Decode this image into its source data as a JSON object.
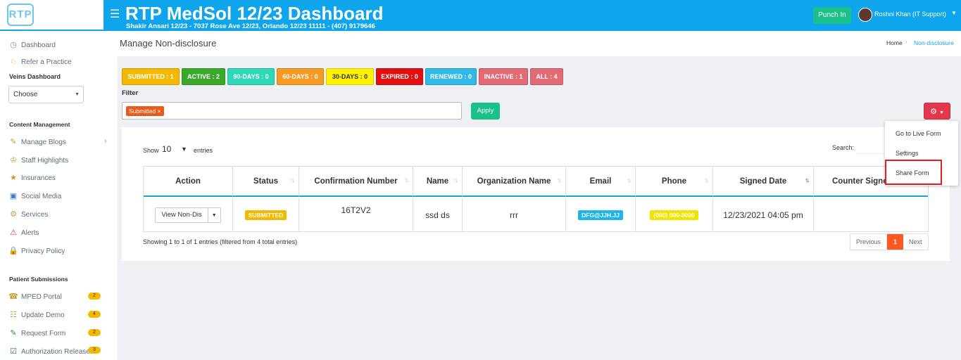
{
  "header": {
    "logo_text": "RTP",
    "title": "RTP MedSol 12/23 Dashboard",
    "subtitle": "Shakir Ansari 12/23 - 7037 Rose Ave 12/23, Orlando 12/23 11111 - (407) 9179646",
    "punch_label": "Punch In",
    "user_name": "Roshni Khan (IT Support)",
    "accent_color": "#0ea5ec"
  },
  "sidebar": {
    "items_top": [
      {
        "label": "Dashboard",
        "icon": "dashboard-icon"
      },
      {
        "label": "Refer a Practice",
        "icon": "refer-icon"
      }
    ],
    "veins_label": "Veins Dashboard",
    "choose_value": "Choose",
    "content_heading": "Content Management",
    "content_items": [
      {
        "label": "Manage Blogs",
        "icon": "blog-icon"
      },
      {
        "label": "Staff Highlights",
        "icon": "staff-icon"
      },
      {
        "label": "Insurances",
        "icon": "insurance-icon"
      },
      {
        "label": "Social Media",
        "icon": "social-icon"
      },
      {
        "label": "Services",
        "icon": "services-icon"
      },
      {
        "label": "Alerts",
        "icon": "alert-icon"
      },
      {
        "label": "Privacy Policy",
        "icon": "privacy-icon"
      }
    ],
    "patient_heading": "Patient Submissions",
    "patient_items": [
      {
        "label": "MPED Portal",
        "badge": "2"
      },
      {
        "label": "Update Demo",
        "badge": "4"
      },
      {
        "label": "Request Form",
        "badge": "2"
      },
      {
        "label": "Authorization Release",
        "badge": "3"
      }
    ]
  },
  "page": {
    "title": "Manage Non-disclosure",
    "breadcrumb_home": "Home",
    "breadcrumb_current": "Non-disclosure"
  },
  "status_buttons": [
    {
      "label": "SUBMITTED : 1",
      "color": "#f5b800"
    },
    {
      "label": "ACTIVE : 2",
      "color": "#3aa82a"
    },
    {
      "label": "90-DAYS : 0",
      "color": "#2ed8b6"
    },
    {
      "label": "60-DAYS : 0",
      "color": "#f59a23"
    },
    {
      "label": "30-DAYS : 0",
      "color": "#fff000"
    },
    {
      "label": "EXPIRED : 0",
      "color": "#e01010"
    },
    {
      "label": "RENEWED : 0",
      "color": "#31b9e8"
    },
    {
      "label": "INACTIVE : 1",
      "color": "#e26a75"
    },
    {
      "label": "ALL : 4",
      "color": "#e26a75"
    }
  ],
  "filter": {
    "label": "Filter",
    "tag": "Submitted ×",
    "apply_label": "Apply"
  },
  "dropdown": {
    "items": [
      "Go to Live Form",
      "Settings",
      "Share Form"
    ]
  },
  "table": {
    "show_label": "Show",
    "show_value": "10",
    "entries_label": "entries",
    "search_label": "Search:",
    "columns": [
      "Action",
      "Status",
      "Confirmation Number",
      "Name",
      "Organization Name",
      "Email",
      "Phone",
      "Signed Date",
      "Counter Signed"
    ],
    "row": {
      "action": "View Non-Dis",
      "status": "SUBMITTED",
      "confirmation": "16T2V2",
      "name": "ssd ds",
      "organization": "rrr",
      "email": "DFG@JJH.JJ",
      "phone": "(000) 000-0000",
      "signed_date": "12/23/2021 04:05 pm",
      "counter_signed": ""
    },
    "showing": "Showing 1 to 1 of 1 entries (filtered from 4 total entries)",
    "pager": {
      "previous": "Previous",
      "current": "1",
      "next": "Next"
    }
  }
}
